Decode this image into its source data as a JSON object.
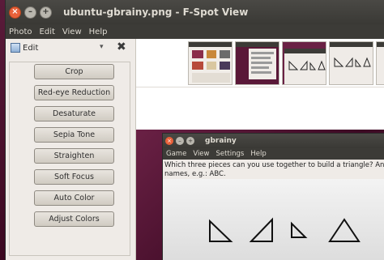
{
  "window": {
    "title": "ubuntu-gbrainy.png - F-Spot View",
    "controls": {
      "close": "×",
      "minimize": "–",
      "maximize": "+"
    }
  },
  "menubar": {
    "items": [
      "Photo",
      "Edit",
      "View",
      "Help"
    ]
  },
  "edit_panel": {
    "title": "Edit",
    "dropdown_icon": "▾",
    "close_icon": "✖",
    "actions": [
      "Crop",
      "Red-eye Reduction",
      "Desaturate",
      "Sepia Tone",
      "Straighten",
      "Soft Focus",
      "Auto Color",
      "Adjust Colors"
    ]
  },
  "gbrainy": {
    "title": "gbrainy",
    "controls": {
      "close": "×",
      "minimize": "–",
      "maximize": "+"
    },
    "menu": [
      "Game",
      "View",
      "Settings",
      "Help"
    ],
    "question_line1": "Which three pieces can you use together to build a triangle? Answer us",
    "question_line2": "names, e.g.: ABC."
  },
  "colors": {
    "titlebar": "#3c3b37",
    "accent_close": "#e8613a",
    "panel_bg": "#efebe7"
  }
}
